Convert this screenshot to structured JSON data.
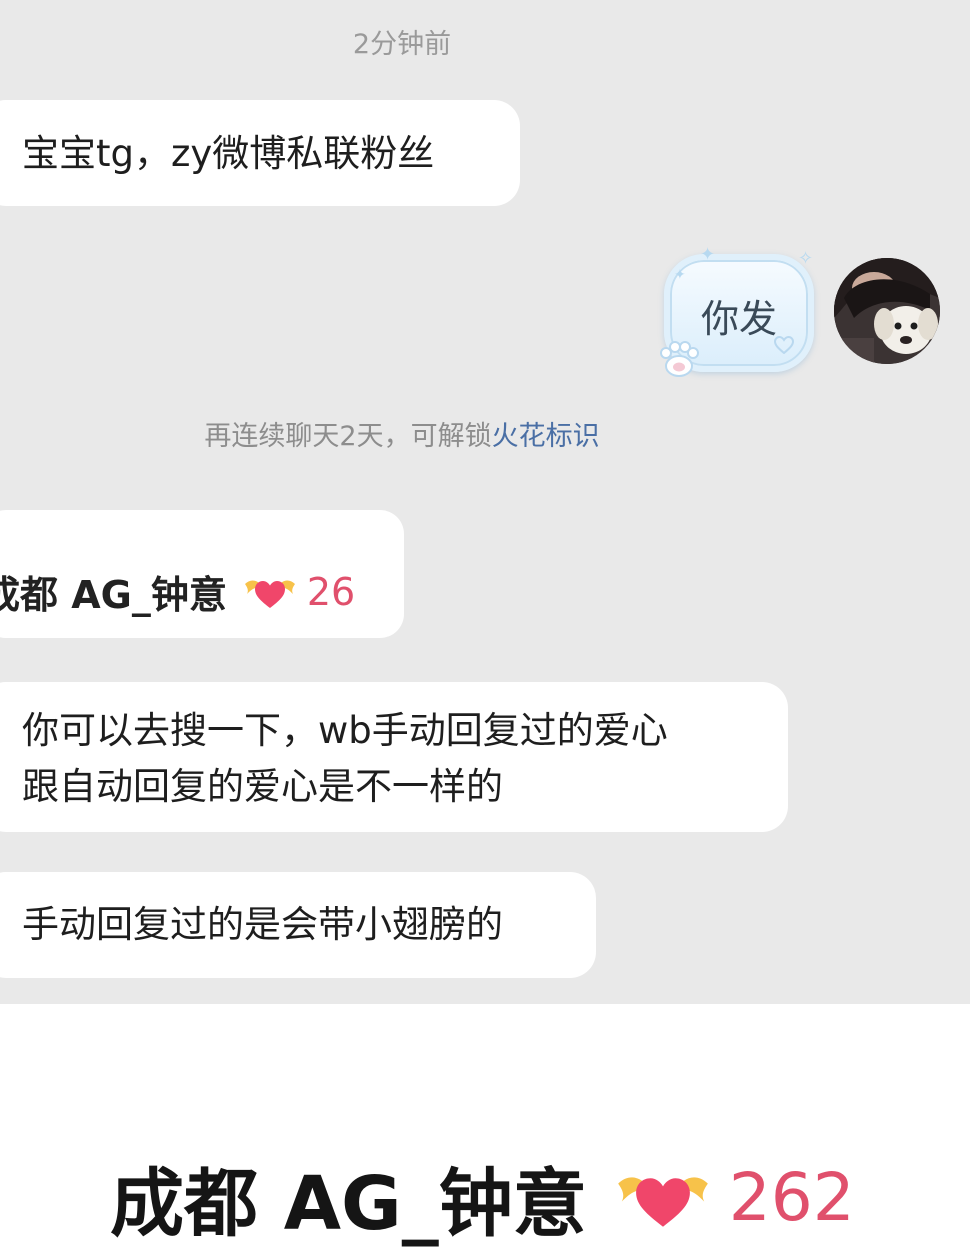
{
  "chat": {
    "timestamp": "2分钟前",
    "messages": [
      {
        "text": "宝宝tg，zy微博私联粉丝"
      },
      {
        "text": "你发"
      },
      {
        "lines": [
          "你可以去搜一下，wb手动回复过的爱心",
          "跟自动回复的爱心是不一样的"
        ]
      },
      {
        "text": "手动回复过的是会带小翅膀的"
      }
    ],
    "system_notice": {
      "prefix": "再连续聊天2天，可解锁",
      "highlight": "火花标识"
    }
  },
  "quoted_card": {
    "name": "成都 AG_钟意",
    "level": "26",
    "icon": "winged-heart-icon"
  },
  "zoomed_card": {
    "name": "成都 AG_钟意",
    "level": "262",
    "icon": "winged-heart-icon"
  },
  "colors": {
    "chat_background": "#e9e9e9",
    "bubble": "#ffffff",
    "highlight_link": "#4a6fa5",
    "level_pink": "#e0506c",
    "heart_red": "#f0466a",
    "wing_yellow": "#f7c24a"
  }
}
